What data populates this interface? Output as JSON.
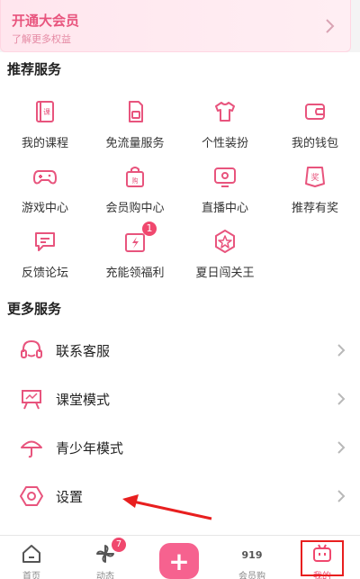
{
  "vip": {
    "title": "开通大会员",
    "subtitle": "了解更多权益"
  },
  "recommended": {
    "title": "推荐服务",
    "items": [
      {
        "label": "我的课程",
        "icon": "course-book-icon"
      },
      {
        "label": "免流量服务",
        "icon": "sim-card-icon"
      },
      {
        "label": "个性装扮",
        "icon": "tshirt-icon"
      },
      {
        "label": "我的钱包",
        "icon": "wallet-icon"
      },
      {
        "label": "游戏中心",
        "icon": "gamepad-icon"
      },
      {
        "label": "会员购中心",
        "icon": "shopping-bag-icon"
      },
      {
        "label": "直播中心",
        "icon": "tv-icon"
      },
      {
        "label": "推荐有奖",
        "icon": "reward-icon"
      },
      {
        "label": "反馈论坛",
        "icon": "chat-bubble-icon"
      },
      {
        "label": "充能领福利",
        "icon": "gift-icon",
        "badge": "1"
      },
      {
        "label": "夏日闯关王",
        "icon": "star-badge-icon"
      }
    ]
  },
  "more": {
    "title": "更多服务",
    "items": [
      {
        "label": "联系客服",
        "icon": "headset-icon"
      },
      {
        "label": "课堂模式",
        "icon": "classroom-icon"
      },
      {
        "label": "青少年模式",
        "icon": "umbrella-icon"
      },
      {
        "label": "设置",
        "icon": "settings-icon"
      }
    ]
  },
  "tabbar": {
    "items": [
      {
        "label": "首页",
        "icon": "home-icon"
      },
      {
        "label": "动态",
        "icon": "pinwheel-icon",
        "badge": "7"
      },
      {
        "label": "",
        "icon": "plus-icon"
      },
      {
        "label": "会员购",
        "icon": "shop-919-icon"
      },
      {
        "label": "我的",
        "icon": "tv-face-icon"
      }
    ]
  },
  "colors": {
    "accent": "#f0486e",
    "highlight": "#e81f1f",
    "vip_bg": "#ffe6ee"
  }
}
